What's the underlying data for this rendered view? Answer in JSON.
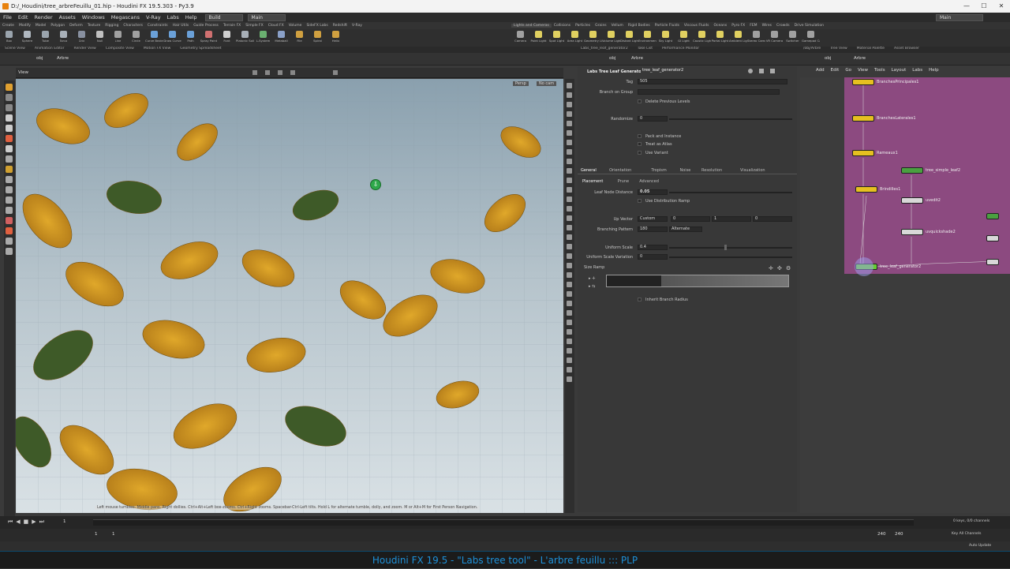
{
  "title_bar": {
    "title": "D:/_Houdini/tree_arbreFeuillu_01.hip - Houdini FX 19.5.303 - Py3.9",
    "min": "—",
    "max": "☐",
    "close": "✕"
  },
  "menu": {
    "items": [
      "File",
      "Edit",
      "Render",
      "Assets",
      "Windows",
      "Megascans",
      "V-Ray",
      "Labs",
      "Help"
    ],
    "desktop_dropdown": "Build",
    "main_dropdown": "Main",
    "right_main_dropdown": "Main"
  },
  "shelf_tabs_left": [
    "Create",
    "Modify",
    "Model",
    "Polygon",
    "Deform",
    "Texture",
    "Rigging",
    "Characters",
    "Constraints",
    "Hair Utils",
    "Guide Process",
    "Terrain FX",
    "Simple FX",
    "Cloud FX",
    "Volume",
    "SideFX Labs",
    "Redshift",
    "V-Ray"
  ],
  "shelf_tabs_right": [
    "Lights and Cameras",
    "Collisions",
    "Particles",
    "Grains",
    "Vellum",
    "Rigid Bodies",
    "Particle Fluids",
    "Viscous Fluids",
    "Oceans",
    "Pyro FX",
    "FEM",
    "Wires",
    "Crowds",
    "Drive Simulation"
  ],
  "shelf_tools_left": [
    {
      "label": "Box",
      "color": "#9aa4ad"
    },
    {
      "label": "Sphere",
      "color": "#b0b8c0"
    },
    {
      "label": "Tube",
      "color": "#9aa4ad"
    },
    {
      "label": "Torus",
      "color": "#a8b0b8"
    },
    {
      "label": "Grid",
      "color": "#8890a0"
    },
    {
      "label": "Null",
      "color": "#c0c0c0"
    },
    {
      "label": "Line",
      "color": "#a0a0a0"
    },
    {
      "label": "Circle",
      "color": "#a0a0a0"
    },
    {
      "label": "Curve Bezier",
      "color": "#6aa0d8"
    },
    {
      "label": "Draw Curve",
      "color": "#6aa0d8"
    },
    {
      "label": "Path",
      "color": "#6aa0d8"
    },
    {
      "label": "Spray Paint",
      "color": "#d07070"
    },
    {
      "label": "Font",
      "color": "#d0d0d0"
    },
    {
      "label": "Platonic Solids",
      "color": "#a8b0b8"
    },
    {
      "label": "L-System",
      "color": "#6ab070"
    },
    {
      "label": "Metaball",
      "color": "#8aa0c8"
    },
    {
      "label": "File",
      "color": "#d0a040"
    },
    {
      "label": "Spiral",
      "color": "#d0a040"
    },
    {
      "label": "Helix",
      "color": "#d0a040"
    }
  ],
  "shelf_tools_right": [
    {
      "label": "Camera",
      "color": "#a0a0a0"
    },
    {
      "label": "Point Light",
      "color": "#e0d060"
    },
    {
      "label": "Spot Light",
      "color": "#e0d060"
    },
    {
      "label": "Area Light",
      "color": "#e0d060"
    },
    {
      "label": "Geometry Light",
      "color": "#e0d060"
    },
    {
      "label": "Volume Light",
      "color": "#e0d060"
    },
    {
      "label": "Distant Light",
      "color": "#e0d060"
    },
    {
      "label": "Environment Light",
      "color": "#e0d060"
    },
    {
      "label": "Sky Light",
      "color": "#e0d060"
    },
    {
      "label": "GI Light",
      "color": "#e0d060"
    },
    {
      "label": "Caustic Light",
      "color": "#e0d060"
    },
    {
      "label": "Portal Light",
      "color": "#e0d060"
    },
    {
      "label": "Ambient Light",
      "color": "#e0d060"
    },
    {
      "label": "Stereo Camera",
      "color": "#a0a0a0"
    },
    {
      "label": "VR Camera",
      "color": "#a0a0a0"
    },
    {
      "label": "Switcher",
      "color": "#a0a0a0"
    },
    {
      "label": "Gamepad Camera",
      "color": "#a0a0a0"
    }
  ],
  "panel_tabs_left": [
    "Scene View",
    "Animation Editor",
    "Render View",
    "Composite View",
    "Motion FX View",
    "Geometry Spreadsheet"
  ],
  "panel_tabs_mid": [
    "Labs_tree_leaf_generator2",
    "Take List",
    "Performance Monitor"
  ],
  "panel_tabs_right": [
    "/obj/Arbre",
    "Tree View",
    "Material Palette",
    "Asset Browser"
  ],
  "path": {
    "root": "obj",
    "node": "Arbre"
  },
  "viewport": {
    "label": "View",
    "persp": "Persp",
    "cam": "No cam",
    "hint": "Left mouse tumbles. Middle pans. Right dollies. Ctrl+Alt+Left box-zooms. Ctrl+Right zooms. Spacebar-Ctrl-Left tilts. Hold L for alternate tumble, dolly, and zoom.    M or Alt+M for First Person Navigation."
  },
  "params": {
    "node_type": "Labs Tree Leaf Generator",
    "node_name": "tree_leaf_generator2",
    "tag_label": "Tag",
    "tag_value": "505",
    "branch_group_label": "Branch on Group",
    "delete_prev": "Delete Previous Levels",
    "randomize_label": "Randomize",
    "randomize_value": "0",
    "pack_instance": "Pack and Instance",
    "treat_atlas": "Treat as Atlas",
    "use_variant": "Use Variant",
    "tabs": [
      "General",
      "Orientation",
      "Tropism",
      "Noise",
      "Resolution",
      "Visualization"
    ],
    "subtabs": [
      "Placement",
      "Prune",
      "Advanced"
    ],
    "leaf_node_distance_label": "Leaf Node Distance",
    "leaf_node_distance": "0.05",
    "use_distribution_ramp": "Use Distribution Ramp",
    "up_vector_label": "Up Vector",
    "up_vector_mode": "Custom",
    "up_vector": [
      "0",
      "1",
      "0"
    ],
    "branching_label": "Branching Pattern",
    "branching_value": "180",
    "branching_mode": "Alternate",
    "uniform_scale_label": "Uniform Scale",
    "uniform_scale": "0.4",
    "uniform_scale_slider": 0.45,
    "uniform_scale_var_label": "Uniform Scale Variation",
    "uniform_scale_var": "0",
    "size_ramp_label": "Size Ramp",
    "inherit_branch_radius": "Inherit Branch Radius"
  },
  "network": {
    "menu": [
      "Add",
      "Edit",
      "Go",
      "View",
      "Tools",
      "Layout",
      "Labs",
      "Help"
    ],
    "nodes": [
      {
        "label": "BranchesPrincipales1",
        "color": "#e6c020"
      },
      {
        "label": "BranchesLaterales1",
        "color": "#e6c020"
      },
      {
        "label": "Rameaux1",
        "color": "#e6c020"
      },
      {
        "label": "tree_simple_leaf2",
        "color": "#4aa040"
      },
      {
        "label": "Brindilles1",
        "color": "#e6c020"
      },
      {
        "label": "uvedit2",
        "color": "#d8d8d8"
      },
      {
        "label": "uvquickshade2",
        "color": "#d8d8d8"
      },
      {
        "label": "tree_leaf_generator2",
        "color": "#66cc33"
      }
    ]
  },
  "timeline": {
    "frame": "1",
    "start": "1",
    "end_a": "240",
    "end_b": "240",
    "start_b": "1",
    "keys": "0 keys, 0/0 channels",
    "key_all": "Key All Channels",
    "auto_update": "Auto Update"
  },
  "caption": "Houdini FX 19.5 -  \"Labs tree tool\"  - L'arbre feuillu ::: PLP"
}
